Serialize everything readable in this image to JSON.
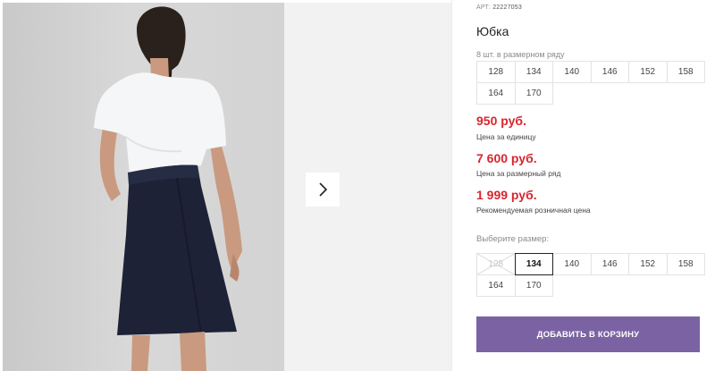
{
  "gallery": {
    "next_icon": "chevron-right-icon"
  },
  "product": {
    "article_label": "АРТ:",
    "article_number": "22227053",
    "title": "Юбка",
    "row_caption": "8 шт. в размерном ряду",
    "row_sizes": [
      "128",
      "134",
      "140",
      "146",
      "152",
      "158",
      "164",
      "170"
    ]
  },
  "prices": {
    "unit_price": "950 руб.",
    "unit_label": "Цена за единицу",
    "row_price": "7 600 руб.",
    "row_label": "Цена за размерный ряд",
    "retail_price": "1 999 руб.",
    "retail_label": "Рекомендуемая розничная цена"
  },
  "size_select": {
    "label": "Выберите размер:",
    "sizes": [
      "128",
      "134",
      "140",
      "146",
      "152",
      "158",
      "164",
      "170"
    ],
    "selected": "134",
    "unavailable": [
      "128"
    ]
  },
  "cart": {
    "add_label": "ДОБАВИТЬ В КОРЗИНУ"
  },
  "colors": {
    "price": "#d9252f",
    "button": "#7b63a3"
  }
}
